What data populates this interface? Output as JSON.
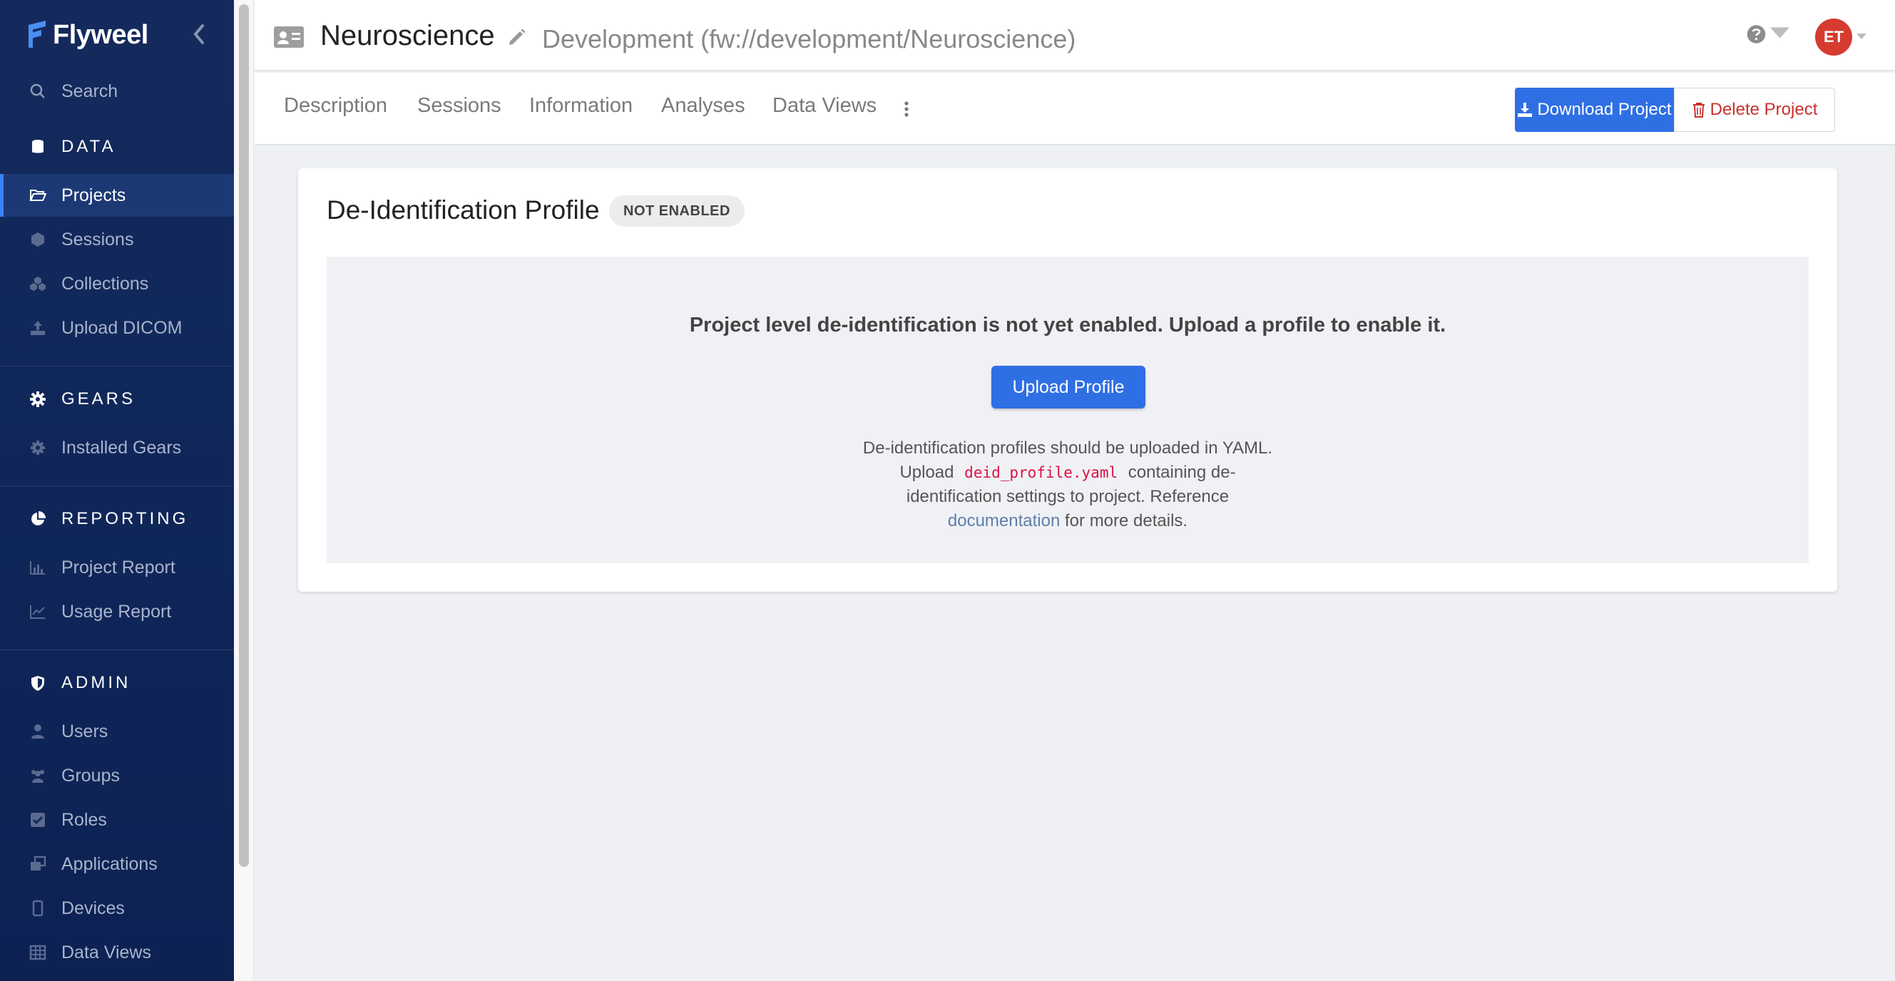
{
  "sidebar": {
    "brand": "Flyweel",
    "search": "Search",
    "sections": {
      "data": "DATA",
      "gears": "GEARS",
      "reporting": "REPORTING",
      "admin": "ADMIN"
    },
    "data_items": [
      "Projects",
      "Sessions",
      "Collections",
      "Upload DICOM"
    ],
    "gears_items": [
      "Installed Gears"
    ],
    "reporting_items": [
      "Project Report",
      "Usage Report"
    ],
    "admin_items": [
      "Users",
      "Groups",
      "Roles",
      "Applications",
      "Devices",
      "Data Views"
    ],
    "active_item": "Projects"
  },
  "header": {
    "title": "Neuroscience",
    "path": "Development (fw://development/Neuroscience)",
    "avatar_initials": "ET"
  },
  "tabs": [
    "Description",
    "Sessions",
    "Information",
    "Analyses",
    "Data Views"
  ],
  "actions": {
    "download": "Download Project",
    "delete": "Delete Project"
  },
  "deid": {
    "title": "De-Identification Profile",
    "badge": "NOT ENABLED",
    "heading": "Project level de-identification is not yet enabled. Upload a profile to enable it.",
    "upload_button": "Upload Profile",
    "text_1": "De-identification profiles should be uploaded in YAML. Upload",
    "filename": "deid_profile.yaml",
    "text_2": "containing de-identification settings to project. Reference",
    "link": "documentation",
    "text_3": "for more details."
  },
  "colors": {
    "sidebar_bg": "#10275a",
    "primary": "#2f6fe4",
    "danger": "#c9302c",
    "avatar": "#d63b30"
  }
}
